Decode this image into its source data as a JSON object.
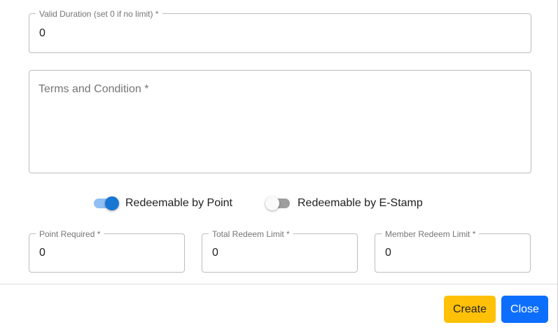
{
  "form": {
    "valid_duration": {
      "label": "Valid Duration (set 0 if no limit) *",
      "value": "0"
    },
    "terms": {
      "placeholder": "Terms and Condition *"
    },
    "toggles": {
      "point": {
        "label": "Redeemable by Point",
        "checked": true
      },
      "estamp": {
        "label": "Redeemable by E-Stamp",
        "checked": false
      }
    },
    "point_required": {
      "label": "Point Required *",
      "value": "0"
    },
    "total_redeem_limit": {
      "label": "Total Redeem Limit *",
      "value": "0"
    },
    "member_redeem_limit": {
      "label": "Member Redeem Limit *",
      "value": "0"
    }
  },
  "footer": {
    "create_label": "Create",
    "close_label": "Close"
  },
  "colors": {
    "create_bg": "#ffc107",
    "create_text": "#212121",
    "close_bg": "#0d6efd",
    "close_text": "#ffffff",
    "switch_on": "#1976d2"
  }
}
